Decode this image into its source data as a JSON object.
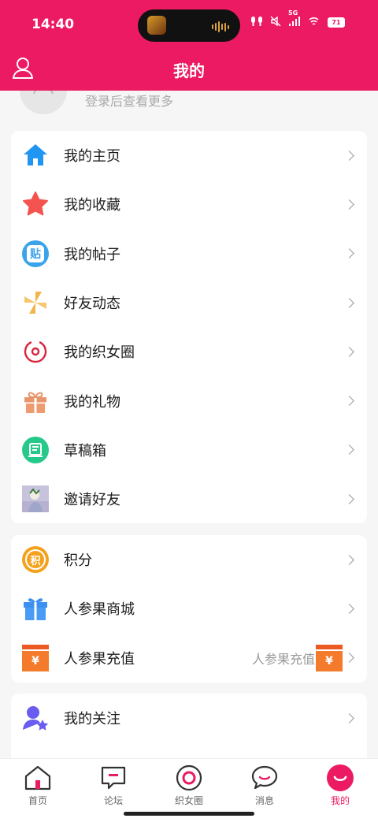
{
  "status": {
    "time": "14:40",
    "network": "5G",
    "battery": "71"
  },
  "header": {
    "title": "我的"
  },
  "profile": {
    "hint": "登录后查看更多"
  },
  "menu_main": [
    {
      "label": "我的主页",
      "icon": "home-icon"
    },
    {
      "label": "我的收藏",
      "icon": "star-icon"
    },
    {
      "label": "我的帖子",
      "icon": "post-icon",
      "icon_text": "贴"
    },
    {
      "label": "好友动态",
      "icon": "pinwheel-icon"
    },
    {
      "label": "我的织女圈",
      "icon": "circle-icon"
    },
    {
      "label": "我的礼物",
      "icon": "gift-icon"
    },
    {
      "label": "草稿箱",
      "icon": "draft-icon"
    },
    {
      "label": "邀请好友",
      "icon": "invite-image"
    }
  ],
  "menu_points": [
    {
      "label": "积分",
      "icon": "points-icon",
      "icon_text": "积"
    },
    {
      "label": "人参果商城",
      "icon": "shop-gift-icon"
    },
    {
      "label": "人参果充值",
      "icon": "recharge-icon",
      "icon_text": "¥",
      "side_text": "人参果充值"
    }
  ],
  "menu_social": [
    {
      "label": "我的关注",
      "icon": "follow-icon"
    }
  ],
  "bottom_nav": [
    {
      "label": "首页",
      "icon": "home-nav-icon"
    },
    {
      "label": "论坛",
      "icon": "forum-icon"
    },
    {
      "label": "织女圈",
      "icon": "circle-nav-icon"
    },
    {
      "label": "消息",
      "icon": "message-icon"
    },
    {
      "label": "我的",
      "icon": "me-icon",
      "active": true
    }
  ],
  "colors": {
    "brand": "#ec1a62",
    "background": "#f6f6f6"
  }
}
